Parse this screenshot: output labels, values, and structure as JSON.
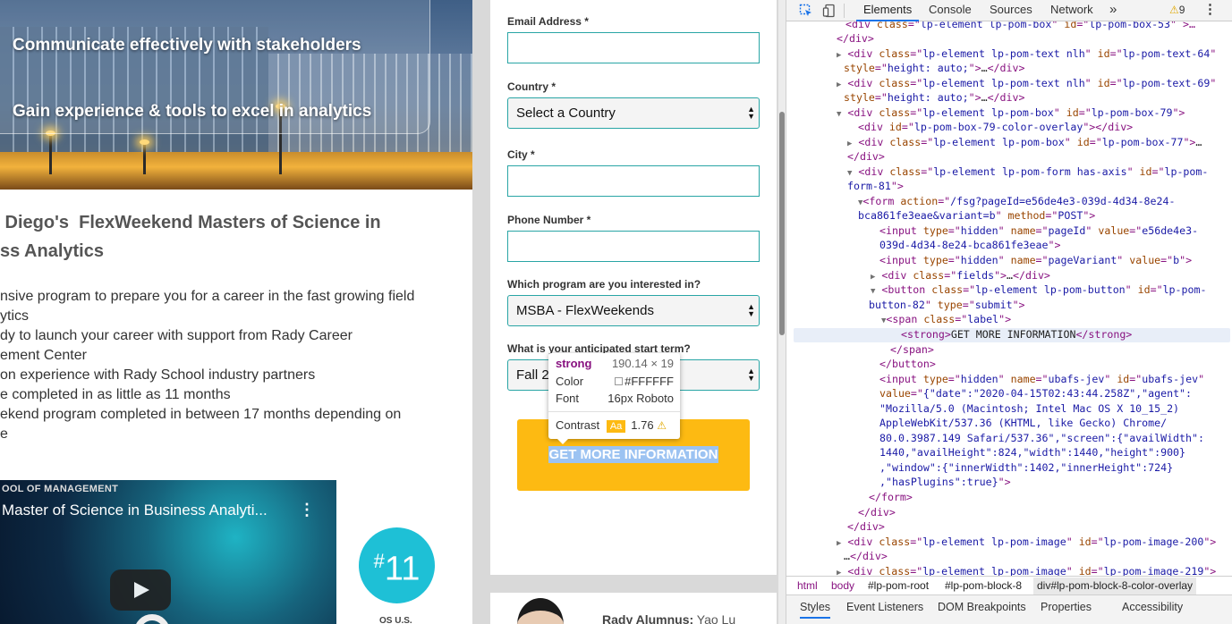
{
  "hero": {
    "line1": "Communicate effectively with stakeholders",
    "line2": "Gain experience & tools to excel in analytics"
  },
  "program": {
    "title_line1": " Diego's  FlexWeekend Masters of Science in",
    "title_line2": "ss Analytics",
    "bullets": [
      "nsive program to prepare you for a career in the fast growing field",
      "ytics",
      "dy to launch your career with support from Rady Career",
      "ement Center",
      "on experience with Rady School industry partners",
      "e completed in as little as 11 months",
      "ekend program completed in between 17 months depending on",
      "e"
    ]
  },
  "video": {
    "school": "OOL OF MANAGEMENT",
    "title": "Master of Science in Business Analyti...",
    "menu_glyph": "⋮"
  },
  "ranking": {
    "prefix": "#",
    "number": "11",
    "caption": "OS U.S."
  },
  "form": {
    "email_label": "Email Address *",
    "country_label": "Country *",
    "country_value": "Select a Country",
    "city_label": "City *",
    "phone_label": "Phone Number *",
    "program_label": "Which program are you interested in?",
    "program_value": "MSBA - FlexWeekends",
    "term_label": "What is your anticipated start term?",
    "term_value": "Fall 20",
    "submit_label": "GET MORE INFORMATION"
  },
  "tooltip": {
    "tag": "strong",
    "dims": "190.14 × 19",
    "color_label": "Color",
    "color_value": "#FFFFFF",
    "font_label": "Font",
    "font_value": "16px Roboto",
    "contrast_label": "Contrast",
    "contrast_badge": "Aa",
    "contrast_value": "1.76",
    "warning_glyph": "⚠"
  },
  "alumni": {
    "label": "Rady Alumnus:",
    "name": " Yao Lu"
  },
  "devtools": {
    "tabs": [
      "Elements",
      "Console",
      "Sources",
      "Network"
    ],
    "more": "»",
    "warnings_count": "9",
    "menu_glyph": "⋮",
    "breadcrumbs": [
      "html",
      "body",
      "#lp-pom-root",
      "#lp-pom-block-8",
      "div#lp-pom-block-8-color-overlay"
    ],
    "subtabs": [
      "Styles",
      "Event Listeners",
      "DOM Breakpoints",
      "Properties",
      "Accessibility"
    ]
  },
  "colors": {
    "accent_teal": "#29a5a5",
    "button_gold": "#fdba12",
    "badge_cyan": "#1ec0d6",
    "devtools_blue": "#1a73e8"
  }
}
